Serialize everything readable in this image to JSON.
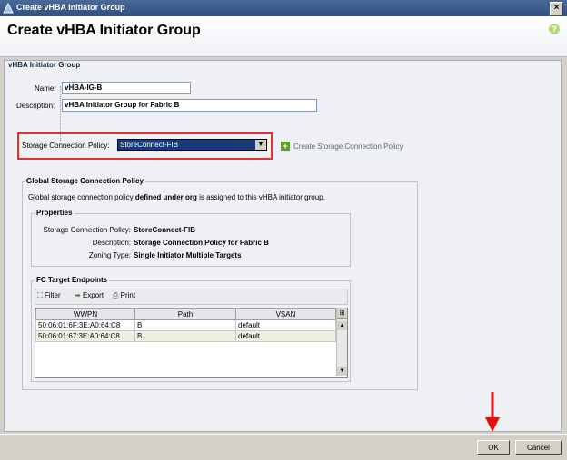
{
  "window": {
    "title": "Create vHBA Initiator Group"
  },
  "header": {
    "title": "Create vHBA Initiator Group"
  },
  "group": {
    "title": "vHBA Initiator Group",
    "name_label": "Name:",
    "name_value": "vHBA-IG-B",
    "description_label": "Description:",
    "description_value": "vHBA Initiator Group for Fabric B"
  },
  "storage_policy": {
    "label": "Storage Connection Policy:",
    "selected": "StoreConnect-FIB",
    "create_link": "Create Storage Connection Policy"
  },
  "global_policy": {
    "title": "Global Storage Connection Policy",
    "note_prefix": "Global storage connection policy ",
    "note_bold": "defined under org",
    "note_suffix": " is assigned to this vHBA initiator group.",
    "properties": {
      "title": "Properties",
      "policy_label": "Storage Connection Policy:",
      "policy_value": "StoreConnect-FIB",
      "description_label": "Description:",
      "description_value": "Storage Connection Policy for Fabric B",
      "zoning_label": "Zoning Type:",
      "zoning_value": "Single Initiator Multiple Targets"
    },
    "endpoints": {
      "title": "FC Target Endpoints",
      "toolbar": {
        "filter": "Filter",
        "export": "Export",
        "print": "Print"
      },
      "columns": [
        "WWPN",
        "Path",
        "VSAN"
      ],
      "rows": [
        [
          "50:06:01:6F:3E:A0:64:C8",
          "B",
          "default"
        ],
        [
          "50:06:01:67:3E:A0:64:C8",
          "B",
          "default"
        ]
      ]
    }
  },
  "footer": {
    "ok": "OK",
    "cancel": "Cancel"
  },
  "colors": {
    "highlight_border": "#e03030",
    "arrow": "#e01010",
    "select_bg": "#1a3a7a"
  }
}
